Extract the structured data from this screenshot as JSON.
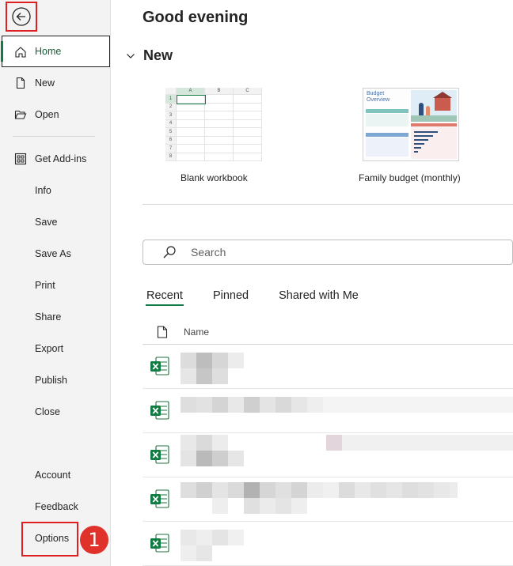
{
  "sidebar": {
    "items": [
      {
        "label": "Home",
        "icon": "home-icon"
      },
      {
        "label": "New",
        "icon": "new-document-icon"
      },
      {
        "label": "Open",
        "icon": "folder-open-icon"
      },
      {
        "label": "Get Add-ins",
        "icon": "add-ins-grid-icon"
      },
      {
        "label": "Info"
      },
      {
        "label": "Save"
      },
      {
        "label": "Save As"
      },
      {
        "label": "Print"
      },
      {
        "label": "Share"
      },
      {
        "label": "Export"
      },
      {
        "label": "Publish"
      },
      {
        "label": "Close"
      },
      {
        "label": "Account"
      },
      {
        "label": "Feedback"
      },
      {
        "label": "Options"
      }
    ],
    "annotation_number": "1"
  },
  "main": {
    "greeting": "Good evening",
    "new_section": "New",
    "templates": [
      {
        "label": "Blank workbook"
      },
      {
        "label": "Family budget (monthly)",
        "thumb_title_line1": "Budget",
        "thumb_title_line2": "Overview"
      }
    ],
    "blank_grid": {
      "columns": [
        "A",
        "B",
        "C"
      ],
      "rows": [
        "1",
        "2",
        "3",
        "4",
        "5",
        "6",
        "7",
        "8"
      ]
    },
    "search": {
      "placeholder": "Search"
    },
    "tabs": [
      {
        "label": "Recent",
        "active": true
      },
      {
        "label": "Pinned",
        "active": false
      },
      {
        "label": "Shared with Me",
        "active": false
      }
    ],
    "list_header": {
      "name_label": "Name"
    },
    "recent_files": [
      {
        "icon": "excel-file-icon"
      },
      {
        "icon": "excel-file-icon"
      },
      {
        "icon": "excel-file-icon"
      },
      {
        "icon": "excel-file-icon"
      },
      {
        "icon": "excel-file-icon"
      }
    ]
  },
  "colors": {
    "accent_green": "#107c41",
    "highlight_red": "#e02020",
    "sidebar_bg": "#f3f3f3"
  }
}
